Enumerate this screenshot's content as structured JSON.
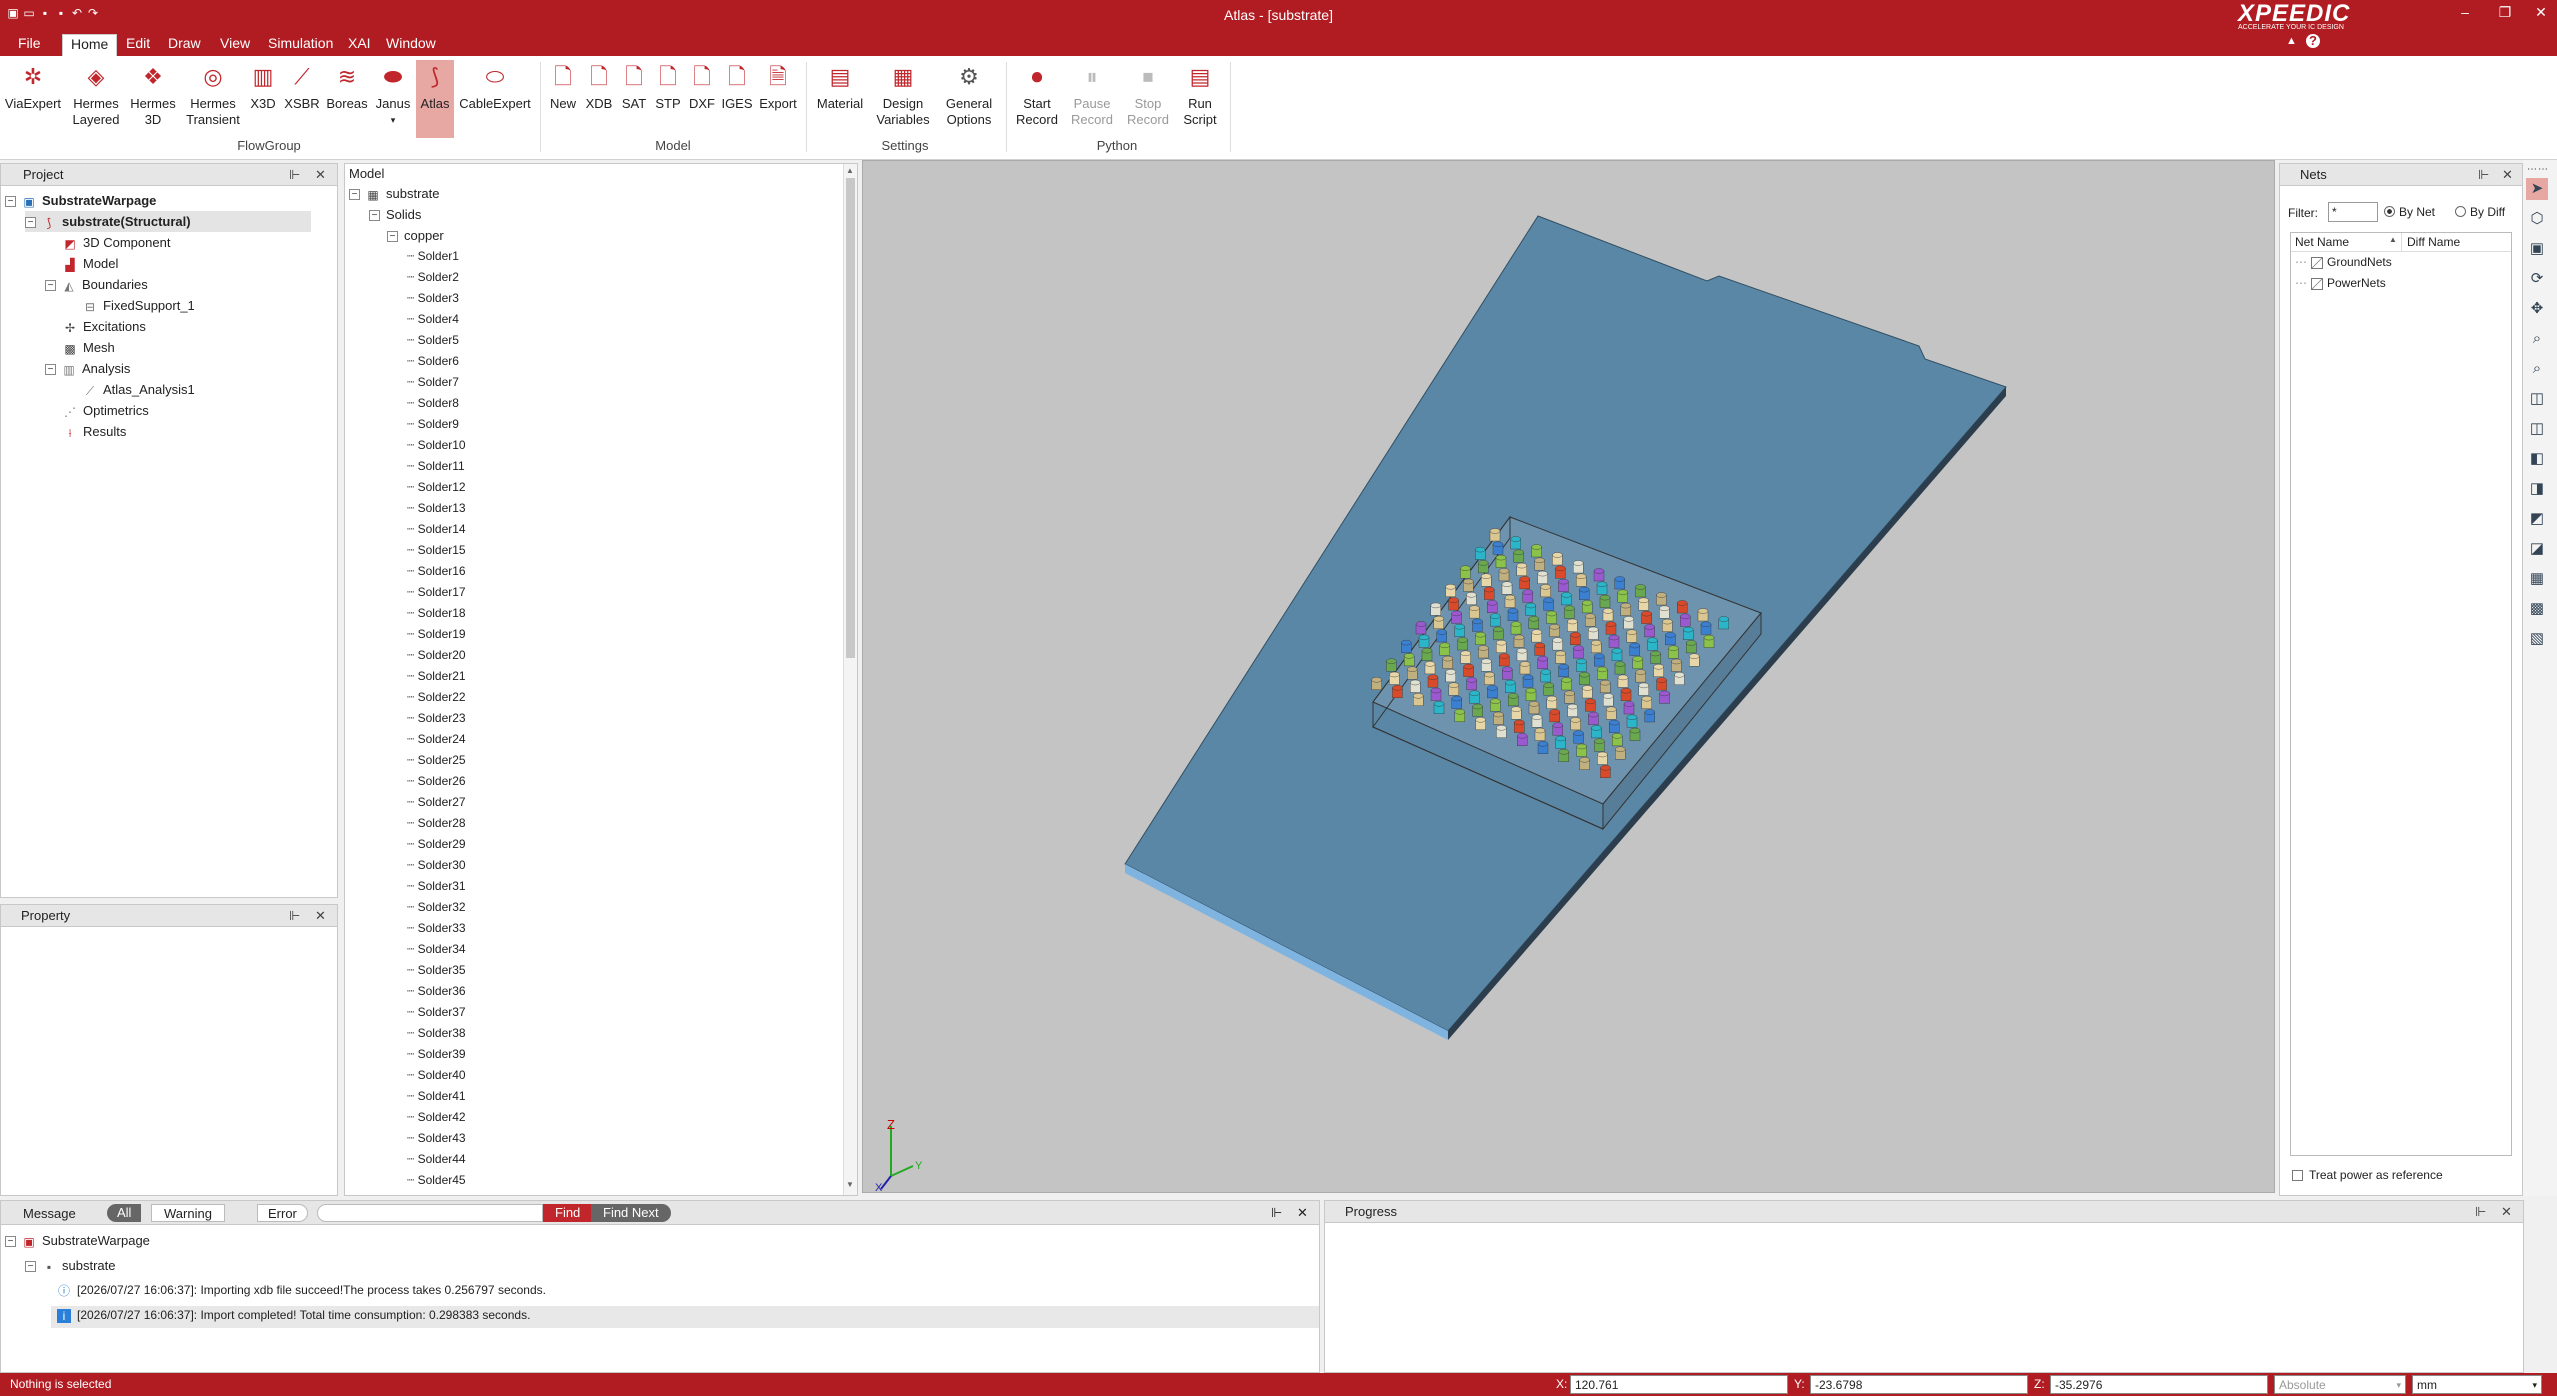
{
  "window": {
    "title": "Atlas - [substrate]",
    "logo": "XPEEDIC",
    "logo_tagline": "ACCELERATE YOUR IC DESIGN"
  },
  "menu": [
    "File",
    "Home",
    "Edit",
    "Draw",
    "View",
    "Simulation",
    "XAI",
    "Window"
  ],
  "ribbon": {
    "flowgroup": [
      "ViaExpert",
      "Hermes\nLayered",
      "Hermes\n3D",
      "Hermes\nTransient",
      "X3D",
      "XSBR",
      "Boreas",
      "Janus",
      "Atlas",
      "CableExpert"
    ],
    "model": [
      "New",
      "XDB",
      "SAT",
      "STP",
      "DXF",
      "IGES",
      "Export"
    ],
    "settings": [
      "Material",
      "Design\nVariables",
      "General\nOptions"
    ],
    "python": [
      "Start\nRecord",
      "Pause\nRecord",
      "Stop\nRecord",
      "Run\nScript"
    ],
    "groups": {
      "flowgroup": "FlowGroup",
      "model": "Model",
      "settings": "Settings",
      "python": "Python"
    }
  },
  "project": {
    "title": "Project",
    "root": "SubstrateWarpage",
    "design": "substrate(Structural)",
    "items": [
      "3D Component",
      "Model",
      "Boundaries",
      "FixedSupport_1",
      "Excitations",
      "Mesh",
      "Analysis",
      "Atlas_Analysis1",
      "Optimetrics",
      "Results"
    ]
  },
  "property": {
    "title": "Property"
  },
  "model": {
    "title": "Model",
    "root": "substrate",
    "solids": "Solids",
    "material": "copper",
    "solders": [
      "Solder1",
      "Solder2",
      "Solder3",
      "Solder4",
      "Solder5",
      "Solder6",
      "Solder7",
      "Solder8",
      "Solder9",
      "Solder10",
      "Solder11",
      "Solder12",
      "Solder13",
      "Solder14",
      "Solder15",
      "Solder16",
      "Solder17",
      "Solder18",
      "Solder19",
      "Solder20",
      "Solder21",
      "Solder22",
      "Solder23",
      "Solder24",
      "Solder25",
      "Solder26",
      "Solder27",
      "Solder28",
      "Solder29",
      "Solder30",
      "Solder31",
      "Solder32",
      "Solder33",
      "Solder34",
      "Solder35",
      "Solder36",
      "Solder37",
      "Solder38",
      "Solder39",
      "Solder40",
      "Solder41",
      "Solder42",
      "Solder43",
      "Solder44",
      "Solder45"
    ]
  },
  "nets": {
    "title": "Nets",
    "filter_label": "Filter:",
    "filter_value": "*",
    "by_net": "By Net",
    "by_diff": "By Diff",
    "col_net": "Net Name",
    "col_diff": "Diff Name",
    "items": [
      "GroundNets",
      "PowerNets"
    ],
    "treat_power": "Treat power as reference"
  },
  "messages": {
    "title": "Message",
    "tabs": [
      "All",
      "Warning",
      "Error"
    ],
    "find": "Find",
    "find_next": "Find Next",
    "root": "SubstrateWarpage",
    "child": "substrate",
    "lines": [
      "[2026/07/27 16:06:37]: Importing xdb file succeed!The process takes 0.256797 seconds.",
      "[2026/07/27 16:06:37]: Import completed! Total time consumption: 0.298383 seconds."
    ]
  },
  "progress": {
    "title": "Progress"
  },
  "status": {
    "text": "Nothing is selected",
    "x_label": "X:",
    "x": "120.761",
    "y_label": "Y:",
    "y": "-23.6798",
    "z_label": "Z:",
    "z": "-35.2976",
    "mode": "Absolute",
    "unit": "mm"
  },
  "colors": {
    "accent": "#b01c22",
    "substrate": "#5b87a6",
    "viewport_bg": "#c4c4c4"
  }
}
